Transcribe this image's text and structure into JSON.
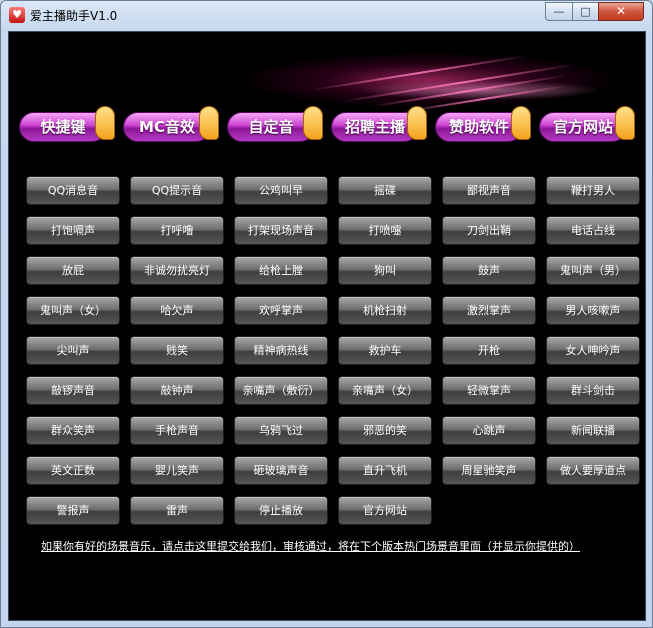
{
  "window": {
    "title": "爱主播助手V1.0",
    "icon_name": "app-logo-icon"
  },
  "controls": {
    "minimize": "—",
    "maximize": "□",
    "close": "✕"
  },
  "colors": {
    "background": "#000000",
    "tab_purple": "#c93fd0",
    "tab_badge": "#f3a51e",
    "button_gray": "#6e6e6e"
  },
  "tabs": [
    {
      "label": "快捷键"
    },
    {
      "label": "MC音效"
    },
    {
      "label": "自定音"
    },
    {
      "label": "招聘主播"
    },
    {
      "label": "赞助软件"
    },
    {
      "label": "官方网站"
    }
  ],
  "sounds": [
    [
      "QQ消息音",
      "QQ提示音",
      "公鸡叫早",
      "摇碟",
      "鄙视声音",
      "鞭打男人"
    ],
    [
      "打饱嗝声",
      "打呼噜",
      "打架现场声音",
      "打喷嚏",
      "刀剑出鞘",
      "电话占线"
    ],
    [
      "放屁",
      "非诚勿扰亮灯",
      "给枪上膛",
      "狗叫",
      "鼓声",
      "鬼叫声（男）"
    ],
    [
      "鬼叫声（女）",
      "哈欠声",
      "欢呼掌声",
      "机枪扫射",
      "激烈掌声",
      "男人咳嗽声"
    ],
    [
      "尖叫声",
      "贱笑",
      "精神病热线",
      "救护车",
      "开枪",
      "女人呻吟声"
    ],
    [
      "敲锣声音",
      "敲钟声",
      "亲嘴声（敷衍）",
      "亲嘴声（女）",
      "轻微掌声",
      "群斗剑击"
    ],
    [
      "群众笑声",
      "手枪声音",
      "乌鸦飞过",
      "邪恶的笑",
      "心跳声",
      "新闻联播"
    ],
    [
      "英文正数",
      "婴儿笑声",
      "砸玻璃声音",
      "直升飞机",
      "周星驰笑声",
      "做人要厚道点"
    ],
    [
      "警报声",
      "雷声",
      "停止播放",
      "官方网站"
    ]
  ],
  "footer": {
    "submit_link": "如果你有好的场景音乐，请点击这里提交给我们，审核通过，将在下个版本热门场景音里面（并显示你提供的）"
  }
}
